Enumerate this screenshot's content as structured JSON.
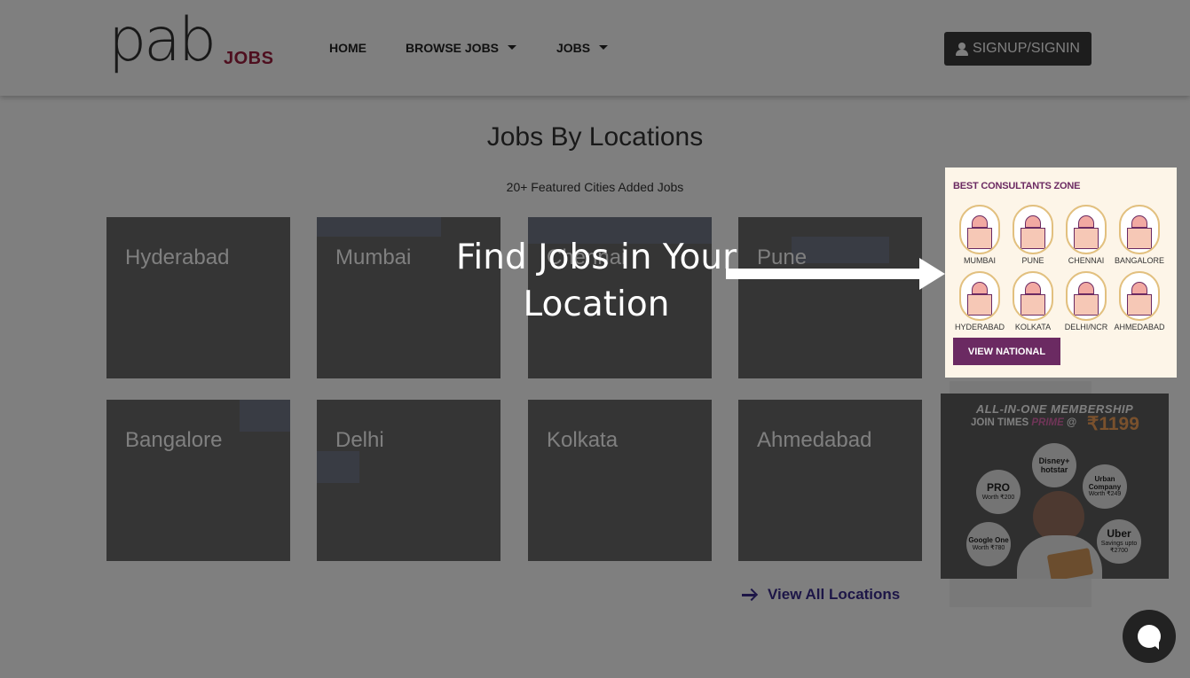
{
  "header": {
    "logo_main": "pab",
    "logo_sub": "JOBS",
    "nav": [
      {
        "label": "HOME",
        "has_dropdown": false
      },
      {
        "label": "BROWSE JOBS",
        "has_dropdown": true
      },
      {
        "label": "JOBS",
        "has_dropdown": true
      }
    ],
    "signin_label": "SIGNUP/SIGNIN",
    "signin_icon": "user-icon"
  },
  "main": {
    "title": "Jobs By Locations",
    "subtitle": "20+ Featured Cities Added Jobs",
    "cities": [
      {
        "name": "Hyderabad"
      },
      {
        "name": "Mumbai"
      },
      {
        "name": "Chennai"
      },
      {
        "name": "Pune"
      },
      {
        "name": "Bangalore"
      },
      {
        "name": "Delhi"
      },
      {
        "name": "Kolkata"
      },
      {
        "name": "Ahmedabad"
      }
    ],
    "view_all_label": "View All Locations",
    "view_all_icon": "arrow-right-icon"
  },
  "ad_consultants": {
    "title": "BEST CONSULTANTS ZONE",
    "cities": [
      "MUMBAI",
      "PUNE",
      "CHENNAI",
      "BANGALORE",
      "HYDERABAD",
      "KOLKATA",
      "DELHI/NCR",
      "AHMEDABAD"
    ],
    "button_label": "VIEW NATIONAL",
    "accent_color": "#6b2a62"
  },
  "ad_membership": {
    "title": "ALL-IN-ONE MEMBERSHIP",
    "join_text": "JOIN TIMES",
    "prime_text": "PRIME",
    "at_text": "@",
    "price": "₹1199",
    "offers": [
      {
        "brand": "Disney+ hotstar",
        "detail": ""
      },
      {
        "brand": "PRO",
        "detail": "Worth ₹200"
      },
      {
        "brand": "Urban Company",
        "detail": "Worth ₹249"
      },
      {
        "brand": "Google One",
        "detail": "Worth ₹780"
      },
      {
        "brand": "Uber",
        "detail": "Savings upto ₹2700"
      }
    ]
  },
  "tour": {
    "message": "Find Jobs in Your Location"
  },
  "chat": {
    "icon": "chat-bubble-icon"
  },
  "colors": {
    "overlay": "rgba(0,0,0,0.5)",
    "link": "#3b2d8f",
    "logo_accent": "#9d1f3e",
    "button": "#3a3a3a"
  }
}
